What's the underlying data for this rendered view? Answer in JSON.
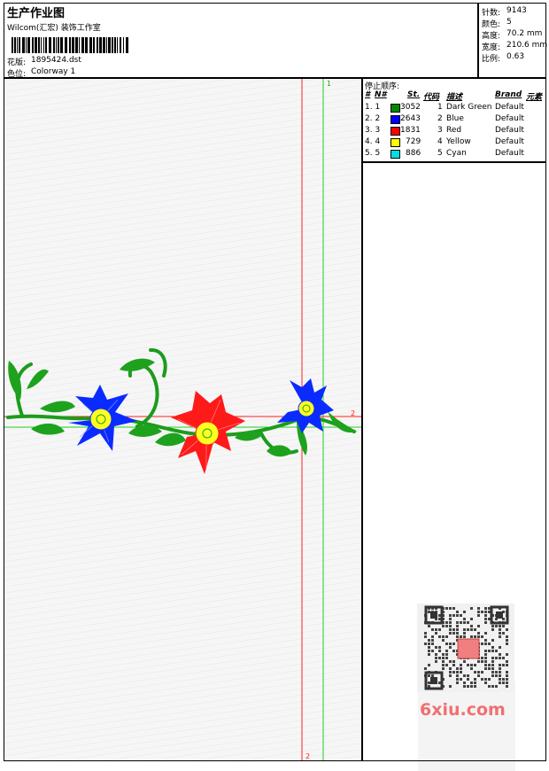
{
  "header": {
    "title": "生产作业图",
    "company": "Wilcom(汇宏) 装饰工作室",
    "design_label": "花版:",
    "design_file": "1895424.dst",
    "colorway_label": "色位:",
    "colorway": "Colorway 1"
  },
  "stats": [
    {
      "label": "针数:",
      "value": "9143"
    },
    {
      "label": "颜色:",
      "value": "5"
    },
    {
      "label": "高度:",
      "value": "70.2 mm"
    },
    {
      "label": "宽度:",
      "value": "210.6 mm"
    },
    {
      "label": "比例:",
      "value": "0.63"
    }
  ],
  "stop_sequence": {
    "title": "停止顺序:",
    "headers": [
      "#",
      "N#",
      "St.",
      "代码",
      "描述",
      "Brand",
      "元素"
    ],
    "rows": [
      {
        "idx": "1. 1",
        "stitches": "3052",
        "code": "1",
        "desc": "Dark Green",
        "brand": "Default",
        "color": "#008a00"
      },
      {
        "idx": "2. 2",
        "stitches": "2643",
        "code": "2",
        "desc": "Blue",
        "brand": "Default",
        "color": "#0000ff"
      },
      {
        "idx": "3. 3",
        "stitches": "1831",
        "code": "3",
        "desc": "Red",
        "brand": "Default",
        "color": "#ff0000"
      },
      {
        "idx": "4. 4",
        "stitches": "729",
        "code": "4",
        "desc": "Yellow",
        "brand": "Default",
        "color": "#ffff00"
      },
      {
        "idx": "5. 5",
        "stitches": "886",
        "code": "5",
        "desc": "Cyan",
        "brand": "Default",
        "color": "#00e0e0"
      }
    ]
  },
  "guides": {
    "green_top": "1",
    "red_right": "2",
    "red_bottom": "2"
  },
  "watermark": {
    "site": "6xiu.com"
  }
}
